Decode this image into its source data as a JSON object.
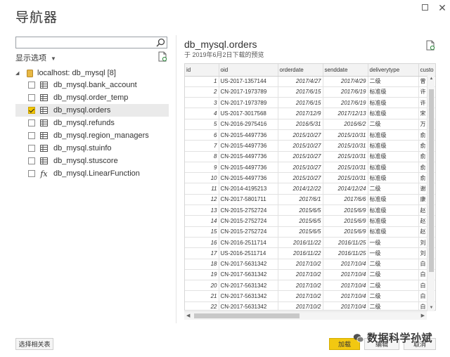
{
  "window": {
    "title": "导航器"
  },
  "left": {
    "search": {
      "placeholder": "",
      "value": ""
    },
    "display_options": "显示选项",
    "tree": {
      "root_label": "localhost: db_mysql [8]",
      "items": [
        {
          "label": "db_mysql.bank_account",
          "type": "table",
          "checked": false
        },
        {
          "label": "db_mysql.order_temp",
          "type": "table",
          "checked": false
        },
        {
          "label": "db_mysql.orders",
          "type": "table",
          "checked": true
        },
        {
          "label": "db_mysql.refunds",
          "type": "table",
          "checked": false
        },
        {
          "label": "db_mysql.region_managers",
          "type": "table",
          "checked": false
        },
        {
          "label": "db_mysql.stuinfo",
          "type": "table",
          "checked": false
        },
        {
          "label": "db_mysql.stuscore",
          "type": "table",
          "checked": false
        },
        {
          "label": "db_mysql.LinearFunction",
          "type": "function",
          "checked": false
        }
      ]
    }
  },
  "preview": {
    "title": "db_mysql.orders",
    "subtitle": "于 2019年6月2日下载的预览",
    "columns": [
      "id",
      "oid",
      "orderdate",
      "senddate",
      "deliverytype",
      "custo"
    ],
    "rows": [
      [
        "1",
        "US-2017-1357144",
        "2017/4/27",
        "2017/4/29",
        "二级",
        "曾"
      ],
      [
        "2",
        "CN-2017-1973789",
        "2017/6/15",
        "2017/6/19",
        "标准级",
        "许"
      ],
      [
        "3",
        "CN-2017-1973789",
        "2017/6/15",
        "2017/6/19",
        "标准级",
        "许"
      ],
      [
        "4",
        "US-2017-3017568",
        "2017/12/9",
        "2017/12/13",
        "标准级",
        "宋"
      ],
      [
        "5",
        "CN-2016-2975416",
        "2016/5/31",
        "2016/6/2",
        "二级",
        "万"
      ],
      [
        "6",
        "CN-2015-4497736",
        "2015/10/27",
        "2015/10/31",
        "标准级",
        "俞"
      ],
      [
        "7",
        "CN-2015-4497736",
        "2015/10/27",
        "2015/10/31",
        "标准级",
        "俞"
      ],
      [
        "8",
        "CN-2015-4497736",
        "2015/10/27",
        "2015/10/31",
        "标准级",
        "俞"
      ],
      [
        "9",
        "CN-2015-4497736",
        "2015/10/27",
        "2015/10/31",
        "标准级",
        "俞"
      ],
      [
        "10",
        "CN-2015-4497736",
        "2015/10/27",
        "2015/10/31",
        "标准级",
        "俞"
      ],
      [
        "11",
        "CN-2014-4195213",
        "2014/12/22",
        "2014/12/24",
        "二级",
        "谢"
      ],
      [
        "12",
        "CN-2017-5801711",
        "2017/6/1",
        "2017/6/6",
        "标准级",
        "康"
      ],
      [
        "13",
        "CN-2015-2752724",
        "2015/6/5",
        "2015/6/9",
        "标准级",
        "赵"
      ],
      [
        "14",
        "CN-2015-2752724",
        "2015/6/5",
        "2015/6/9",
        "标准级",
        "赵"
      ],
      [
        "15",
        "CN-2015-2752724",
        "2015/6/5",
        "2015/6/9",
        "标准级",
        "赵"
      ],
      [
        "16",
        "CN-2016-2511714",
        "2016/11/22",
        "2016/11/25",
        "一级",
        "刘"
      ],
      [
        "17",
        "US-2016-2511714",
        "2016/11/22",
        "2016/11/25",
        "一级",
        "刘"
      ],
      [
        "18",
        "CN-2017-5631342",
        "2017/10/2",
        "2017/10/4",
        "二级",
        "白"
      ],
      [
        "19",
        "CN-2017-5631342",
        "2017/10/2",
        "2017/10/4",
        "二级",
        "白"
      ],
      [
        "20",
        "CN-2017-5631342",
        "2017/10/2",
        "2017/10/4",
        "二级",
        "白"
      ],
      [
        "21",
        "CN-2017-5631342",
        "2017/10/2",
        "2017/10/4",
        "二级",
        "白"
      ],
      [
        "22",
        "CN-2017-5631342",
        "2017/10/2",
        "2017/10/4",
        "二级",
        "白"
      ]
    ]
  },
  "footer": {
    "select_related": "选择相关表",
    "load": "加载",
    "edit": "编辑",
    "cancel": "取消"
  },
  "watermark": {
    "text": "数据科学孙斌"
  },
  "colors": {
    "accent": "#f2c811",
    "selected_row": "#eaeaea"
  }
}
